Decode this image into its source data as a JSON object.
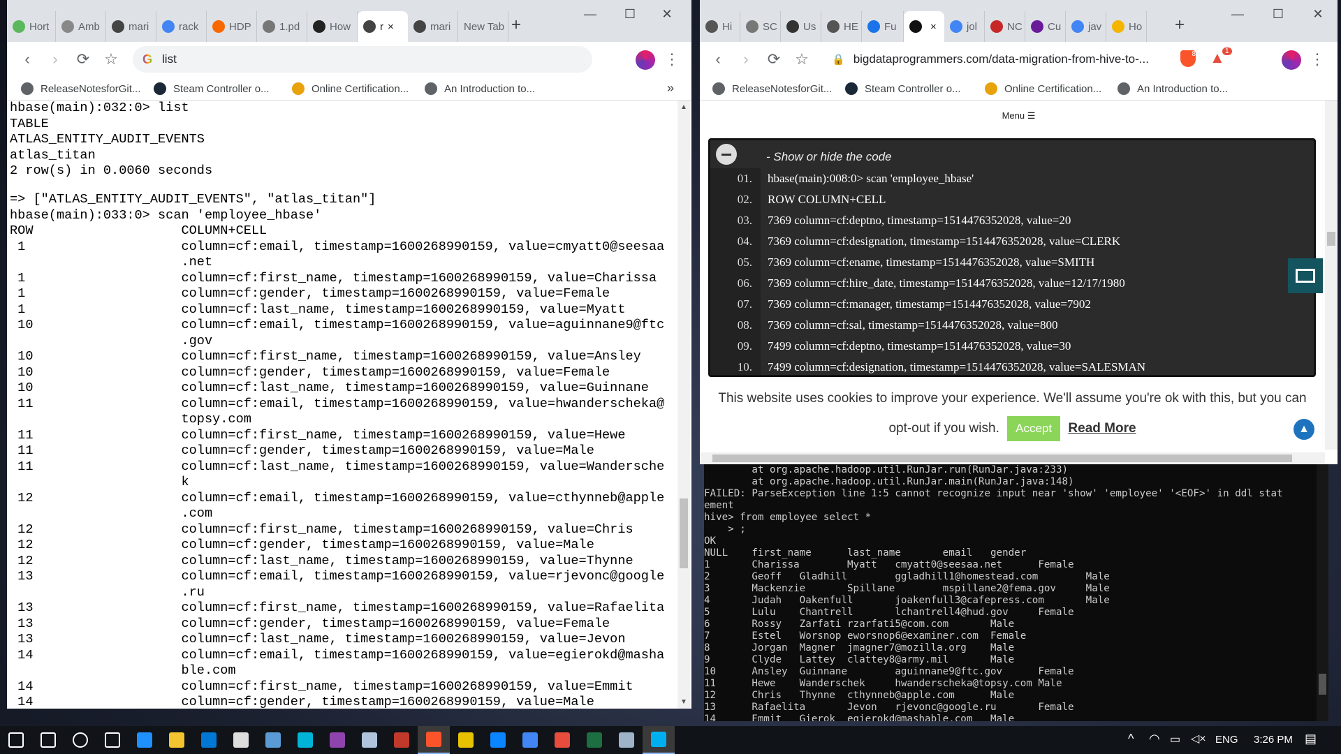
{
  "left_browser": {
    "tabs": [
      {
        "label": "Hort",
        "icon": "hortonworks-icon",
        "color": "#5cb85c"
      },
      {
        "label": "Amb",
        "icon": "ambari-icon",
        "color": "#888888"
      },
      {
        "label": "mari",
        "icon": "page-icon",
        "color": "#444444"
      },
      {
        "label": "rack",
        "icon": "google-icon",
        "color": "#4285f4"
      },
      {
        "label": "HDP",
        "icon": "cloudera-icon",
        "color": "#f96702"
      },
      {
        "label": "1.pd",
        "icon": "globe-icon",
        "color": "#777777"
      },
      {
        "label": "How",
        "icon": "hexagon-icon",
        "color": "#222222"
      },
      {
        "label": "r",
        "icon": "page-icon",
        "color": "#444444"
      },
      {
        "label": "mari",
        "icon": "page-icon",
        "color": "#444444"
      },
      {
        "label": "New Tab",
        "icon": "",
        "color": ""
      }
    ],
    "active_tab_close": "×",
    "new_tab_symbol": "+",
    "window_controls": {
      "minimize": "—",
      "maximize": "☐",
      "close": "✕"
    },
    "omnibox_text": "list",
    "bookmarks": [
      {
        "label": "ReleaseNotesforGit...",
        "color": "#5f6368"
      },
      {
        "label": "Steam Controller o...",
        "color": "#1b2838"
      },
      {
        "label": "Online Certification...",
        "color": "#e8a20c"
      },
      {
        "label": "An Introduction to...",
        "color": "#5f6368"
      }
    ],
    "bookmarks_more": "»"
  },
  "terminal_lines": [
    "hbase(main):032:0> list",
    "TABLE",
    "ATLAS_ENTITY_AUDIT_EVENTS",
    "atlas_titan",
    "2 row(s) in 0.0060 seconds",
    "",
    "=> [\"ATLAS_ENTITY_AUDIT_EVENTS\", \"atlas_titan\"]",
    "hbase(main):033:0> scan 'employee_hbase'",
    "ROW                   COLUMN+CELL",
    " 1                    column=cf:email, timestamp=1600268990159, value=cmyatt0@seesaa",
    "                      .net",
    " 1                    column=cf:first_name, timestamp=1600268990159, value=Charissa",
    " 1                    column=cf:gender, timestamp=1600268990159, value=Female",
    " 1                    column=cf:last_name, timestamp=1600268990159, value=Myatt",
    " 10                   column=cf:email, timestamp=1600268990159, value=aguinnane9@ftc",
    "                      .gov",
    " 10                   column=cf:first_name, timestamp=1600268990159, value=Ansley",
    " 10                   column=cf:gender, timestamp=1600268990159, value=Female",
    " 10                   column=cf:last_name, timestamp=1600268990159, value=Guinnane",
    " 11                   column=cf:email, timestamp=1600268990159, value=hwanderscheka@",
    "                      topsy.com",
    " 11                   column=cf:first_name, timestamp=1600268990159, value=Hewe",
    " 11                   column=cf:gender, timestamp=1600268990159, value=Male",
    " 11                   column=cf:last_name, timestamp=1600268990159, value=Wandersche",
    "                      k",
    " 12                   column=cf:email, timestamp=1600268990159, value=cthynneb@apple",
    "                      .com",
    " 12                   column=cf:first_name, timestamp=1600268990159, value=Chris",
    " 12                   column=cf:gender, timestamp=1600268990159, value=Male",
    " 12                   column=cf:last_name, timestamp=1600268990159, value=Thynne",
    " 13                   column=cf:email, timestamp=1600268990159, value=rjevonc@google",
    "                      .ru",
    " 13                   column=cf:first_name, timestamp=1600268990159, value=Rafaelita",
    " 13                   column=cf:gender, timestamp=1600268990159, value=Female",
    " 13                   column=cf:last_name, timestamp=1600268990159, value=Jevon",
    " 14                   column=cf:email, timestamp=1600268990159, value=egierokd@masha",
    "                      ble.com",
    " 14                   column=cf:first_name, timestamp=1600268990159, value=Emmit",
    " 14                   column=cf:gender, timestamp=1600268990159, value=Male"
  ],
  "right_browser": {
    "tabs": [
      {
        "label": "Hi",
        "icon": "hexagon-icon",
        "color": "#555555"
      },
      {
        "label": "SC",
        "icon": "globe-icon",
        "color": "#777777"
      },
      {
        "label": "Us",
        "icon": "page-icon",
        "color": "#333333"
      },
      {
        "label": "HE",
        "icon": "hexagon-icon",
        "color": "#555555"
      },
      {
        "label": "Fu",
        "icon": "infinity-icon",
        "color": "#1a73e8"
      },
      {
        "label": "",
        "icon": "site-icon",
        "color": "#111111"
      },
      {
        "label": "jol",
        "icon": "google-icon",
        "color": "#4285f4"
      },
      {
        "label": "NC",
        "icon": "page-icon",
        "color": "#c62828"
      },
      {
        "label": "Cu",
        "icon": "page-icon",
        "color": "#6a1b9a"
      },
      {
        "label": "jav",
        "icon": "google-icon",
        "color": "#4285f4"
      },
      {
        "label": "Ho",
        "icon": "page-icon",
        "color": "#f4b400"
      }
    ],
    "active_tab_close": "×",
    "new_tab_symbol": "+",
    "window_controls": {
      "minimize": "—",
      "maximize": "☐",
      "close": "✕"
    },
    "url": "bigdataprogrammers.com/data-migration-from-hive-to-...",
    "brave_badge": "8",
    "alert_badge": "1",
    "bookmarks": [
      {
        "label": "ReleaseNotesforGit...",
        "color": "#5f6368"
      },
      {
        "label": "Steam Controller o...",
        "color": "#1b2838"
      },
      {
        "label": "Online Certification...",
        "color": "#e8a20c"
      },
      {
        "label": "An Introduction to...",
        "color": "#5f6368"
      }
    ],
    "menu_label": "Menu ☰",
    "code_header": "- Show or hide the code",
    "code_lines": [
      {
        "num": "01.",
        "text": "hbase(main):008:0> scan 'employee_hbase'"
      },
      {
        "num": "02.",
        "text": "ROW COLUMN+CELL"
      },
      {
        "num": "03.",
        "text": "7369 column=cf:deptno, timestamp=1514476352028, value=20"
      },
      {
        "num": "04.",
        "text": "7369 column=cf:designation, timestamp=1514476352028, value=CLERK"
      },
      {
        "num": "05.",
        "text": "7369 column=cf:ename, timestamp=1514476352028, value=SMITH"
      },
      {
        "num": "06.",
        "text": "7369 column=cf:hire_date, timestamp=1514476352028, value=12/17/1980"
      },
      {
        "num": "07.",
        "text": "7369 column=cf:manager, timestamp=1514476352028, value=7902"
      },
      {
        "num": "08.",
        "text": "7369 column=cf:sal, timestamp=1514476352028, value=800"
      },
      {
        "num": "09.",
        "text": "7499 column=cf:deptno, timestamp=1514476352028, value=30"
      },
      {
        "num": "10.",
        "text": "7499 column=cf:designation, timestamp=1514476352028, value=SALESMAN"
      }
    ],
    "cookie_text_1": "This website uses cookies to improve your experience. We'll assume you're ok with this, but you can",
    "cookie_text_2": "opt-out if you wish.",
    "accept_label": "Accept",
    "read_more_label": "Read More"
  },
  "hive_console_lines": [
    "        at org.apache.hadoop.util.RunJar.run(RunJar.java:233)",
    "        at org.apache.hadoop.util.RunJar.main(RunJar.java:148)",
    "FAILED: ParseException line 1:5 cannot recognize input near 'show' 'employee' '<EOF>' in ddl stat",
    "ement",
    "hive> from employee select *",
    "    > ;",
    "OK",
    "NULL    first_name      last_name       email   gender",
    "1       Charissa        Myatt   cmyatt0@seesaa.net      Female",
    "2       Geoff   Gladhill        ggladhill1@homestead.com        Male",
    "3       Mackenzie       Spillane        mspillane2@fema.gov     Male",
    "4       Judah   Oakenfull       joakenfull3@cafepress.com       Male",
    "5       Lulu    Chantrell       lchantrell4@hud.gov     Female",
    "6       Rossy   Zarfati rzarfati5@com.com       Male",
    "7       Estel   Worsnop eworsnop6@examiner.com  Female",
    "8       Jorgan  Magner  jmagner7@mozilla.org    Male",
    "9       Clyde   Lattey  clattey8@army.mil       Male",
    "10      Ansley  Guinnane        aguinnane9@ftc.gov      Female",
    "11      Hewe    Wanderschek     hwanderscheka@topsy.com Male",
    "12      Chris   Thynne  cthynneb@apple.com      Male",
    "13      Rafaelita       Jevon   rjevonc@google.ru       Female",
    "14      Emmit   Gierok  egierokd@mashable.com   Male"
  ],
  "taskbar": {
    "apps": [
      {
        "name": "start-icon",
        "color": "#ffffff"
      },
      {
        "name": "search-icon",
        "color": "#ffffff"
      },
      {
        "name": "cortana-icon",
        "color": "#ffffff"
      },
      {
        "name": "task-view-icon",
        "color": "#ffffff"
      },
      {
        "name": "edge-icon",
        "color": "#1e90ff"
      },
      {
        "name": "file-explorer-icon",
        "color": "#f4c430"
      },
      {
        "name": "mail-icon",
        "color": "#0078d4"
      },
      {
        "name": "store-icon",
        "color": "#dddddd"
      },
      {
        "name": "remote-icon",
        "color": "#5b9bd5"
      },
      {
        "name": "ide-icon",
        "color": "#00b4d8"
      },
      {
        "name": "visual-studio-icon",
        "color": "#8e44ad"
      },
      {
        "name": "virtualbox-icon",
        "color": "#b0c4de"
      },
      {
        "name": "filezilla-icon",
        "color": "#c0392b"
      },
      {
        "name": "brave-icon",
        "color": "#fb542b"
      },
      {
        "name": "git-icon",
        "color": "#e6c200"
      },
      {
        "name": "photos-icon",
        "color": "#0a84ff"
      },
      {
        "name": "chrome-icon",
        "color": "#4285f4"
      },
      {
        "name": "cloud-icon",
        "color": "#e74c3c"
      },
      {
        "name": "excel-icon",
        "color": "#1d6f42"
      },
      {
        "name": "screen-icon",
        "color": "#9fb3c8"
      },
      {
        "name": "skype-icon",
        "color": "#00aff0"
      }
    ],
    "language": "ENG",
    "time": "3:26 PM"
  }
}
